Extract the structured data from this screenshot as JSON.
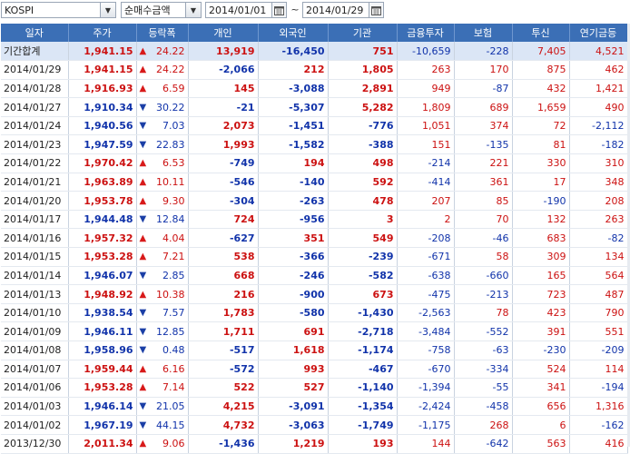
{
  "toolbar": {
    "market": "KOSPI",
    "metric": "순매수금액",
    "date_from": "2014/01/01",
    "date_to": "2014/01/29",
    "separator": "~"
  },
  "columns": [
    "일자",
    "주가",
    "등락폭",
    "개인",
    "외국인",
    "기관",
    "금융투자",
    "보험",
    "투신",
    "연기금등"
  ],
  "rows": [
    {
      "date": "기간합계",
      "price": "1,941.15",
      "dir": "up",
      "chg": "24.22",
      "ind": "13,919",
      "for": "-16,450",
      "inst": "751",
      "fin": "-10,659",
      "ins": "-228",
      "tru": "7,405",
      "pen": "4,521",
      "sum": true
    },
    {
      "date": "2014/01/29",
      "price": "1,941.15",
      "dir": "up",
      "chg": "24.22",
      "ind": "-2,066",
      "for": "212",
      "inst": "1,805",
      "fin": "263",
      "ins": "170",
      "tru": "875",
      "pen": "462"
    },
    {
      "date": "2014/01/28",
      "price": "1,916.93",
      "dir": "up",
      "chg": "6.59",
      "ind": "145",
      "for": "-3,088",
      "inst": "2,891",
      "fin": "949",
      "ins": "-87",
      "tru": "432",
      "pen": "1,421"
    },
    {
      "date": "2014/01/27",
      "price": "1,910.34",
      "dir": "down",
      "chg": "30.22",
      "ind": "-21",
      "for": "-5,307",
      "inst": "5,282",
      "fin": "1,809",
      "ins": "689",
      "tru": "1,659",
      "pen": "490"
    },
    {
      "date": "2014/01/24",
      "price": "1,940.56",
      "dir": "down",
      "chg": "7.03",
      "ind": "2,073",
      "for": "-1,451",
      "inst": "-776",
      "fin": "1,051",
      "ins": "374",
      "tru": "72",
      "pen": "-2,112"
    },
    {
      "date": "2014/01/23",
      "price": "1,947.59",
      "dir": "down",
      "chg": "22.83",
      "ind": "1,993",
      "for": "-1,582",
      "inst": "-388",
      "fin": "151",
      "ins": "-135",
      "tru": "81",
      "pen": "-182"
    },
    {
      "date": "2014/01/22",
      "price": "1,970.42",
      "dir": "up",
      "chg": "6.53",
      "ind": "-749",
      "for": "194",
      "inst": "498",
      "fin": "-214",
      "ins": "221",
      "tru": "330",
      "pen": "310"
    },
    {
      "date": "2014/01/21",
      "price": "1,963.89",
      "dir": "up",
      "chg": "10.11",
      "ind": "-546",
      "for": "-140",
      "inst": "592",
      "fin": "-414",
      "ins": "361",
      "tru": "17",
      "pen": "348"
    },
    {
      "date": "2014/01/20",
      "price": "1,953.78",
      "dir": "up",
      "chg": "9.30",
      "ind": "-304",
      "for": "-263",
      "inst": "478",
      "fin": "207",
      "ins": "85",
      "tru": "-190",
      "pen": "208"
    },
    {
      "date": "2014/01/17",
      "price": "1,944.48",
      "dir": "down",
      "chg": "12.84",
      "ind": "724",
      "for": "-956",
      "inst": "3",
      "fin": "2",
      "ins": "70",
      "tru": "132",
      "pen": "263"
    },
    {
      "date": "2014/01/16",
      "price": "1,957.32",
      "dir": "up",
      "chg": "4.04",
      "ind": "-627",
      "for": "351",
      "inst": "549",
      "fin": "-208",
      "ins": "-46",
      "tru": "683",
      "pen": "-82"
    },
    {
      "date": "2014/01/15",
      "price": "1,953.28",
      "dir": "up",
      "chg": "7.21",
      "ind": "538",
      "for": "-366",
      "inst": "-239",
      "fin": "-671",
      "ins": "58",
      "tru": "309",
      "pen": "134"
    },
    {
      "date": "2014/01/14",
      "price": "1,946.07",
      "dir": "down",
      "chg": "2.85",
      "ind": "668",
      "for": "-246",
      "inst": "-582",
      "fin": "-638",
      "ins": "-660",
      "tru": "165",
      "pen": "564"
    },
    {
      "date": "2014/01/13",
      "price": "1,948.92",
      "dir": "up",
      "chg": "10.38",
      "ind": "216",
      "for": "-900",
      "inst": "673",
      "fin": "-475",
      "ins": "-213",
      "tru": "723",
      "pen": "487"
    },
    {
      "date": "2014/01/10",
      "price": "1,938.54",
      "dir": "down",
      "chg": "7.57",
      "ind": "1,783",
      "for": "-580",
      "inst": "-1,430",
      "fin": "-2,563",
      "ins": "78",
      "tru": "423",
      "pen": "790"
    },
    {
      "date": "2014/01/09",
      "price": "1,946.11",
      "dir": "down",
      "chg": "12.85",
      "ind": "1,711",
      "for": "691",
      "inst": "-2,718",
      "fin": "-3,484",
      "ins": "-552",
      "tru": "391",
      "pen": "551"
    },
    {
      "date": "2014/01/08",
      "price": "1,958.96",
      "dir": "down",
      "chg": "0.48",
      "ind": "-517",
      "for": "1,618",
      "inst": "-1,174",
      "fin": "-758",
      "ins": "-63",
      "tru": "-230",
      "pen": "-209"
    },
    {
      "date": "2014/01/07",
      "price": "1,959.44",
      "dir": "up",
      "chg": "6.16",
      "ind": "-572",
      "for": "993",
      "inst": "-467",
      "fin": "-670",
      "ins": "-334",
      "tru": "524",
      "pen": "114"
    },
    {
      "date": "2014/01/06",
      "price": "1,953.28",
      "dir": "up",
      "chg": "7.14",
      "ind": "522",
      "for": "527",
      "inst": "-1,140",
      "fin": "-1,394",
      "ins": "-55",
      "tru": "341",
      "pen": "-194"
    },
    {
      "date": "2014/01/03",
      "price": "1,946.14",
      "dir": "down",
      "chg": "21.05",
      "ind": "4,215",
      "for": "-3,091",
      "inst": "-1,354",
      "fin": "-2,424",
      "ins": "-458",
      "tru": "656",
      "pen": "1,316"
    },
    {
      "date": "2014/01/02",
      "price": "1,967.19",
      "dir": "down",
      "chg": "44.15",
      "ind": "4,732",
      "for": "-3,063",
      "inst": "-1,749",
      "fin": "-1,175",
      "ins": "268",
      "tru": "6",
      "pen": "-162"
    },
    {
      "date": "2013/12/30",
      "price": "2,011.34",
      "dir": "up",
      "chg": "9.06",
      "ind": "-1,436",
      "for": "1,219",
      "inst": "193",
      "fin": "144",
      "ins": "-642",
      "tru": "563",
      "pen": "416"
    }
  ],
  "colors": {
    "header_bg": "#3b6fb6",
    "up": "#cc1111",
    "down": "#1133aa",
    "summary_bg": "#dbe6f6"
  },
  "icons": {
    "up": "triangle-up-icon",
    "down": "triangle-down-icon",
    "dropdown": "chevron-down-icon",
    "calendar": "calendar-icon"
  }
}
